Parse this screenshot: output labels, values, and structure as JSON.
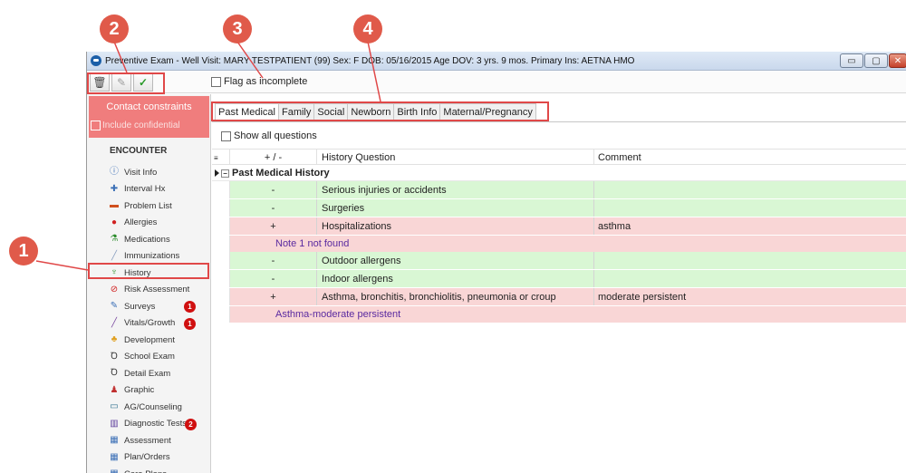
{
  "window": {
    "title": "Preventive Exam - Well Visit:  MARY TESTPATIENT (99)  Sex: F  DOB: 05/16/2015  Age DOV: 3 yrs. 9 mos.  Primary Ins: AETNA HMO",
    "controls": {
      "minimize": "▭",
      "maximize": "▢",
      "close": "✕"
    }
  },
  "toolbar": {
    "delete_icon": "trash-icon",
    "edit_icon": "pencil-icon",
    "confirm_icon": "check-icon",
    "flag_incomplete_label": "Flag as incomplete"
  },
  "sidebar": {
    "contact_constraints": "Contact constraints",
    "include_confidential": "Include confidential",
    "section_header": "ENCOUNTER",
    "items": [
      {
        "label": "Visit Info",
        "icon": "visit-info-icon",
        "glyph": "ⓘ",
        "color": "#3b6fb6"
      },
      {
        "label": "Interval Hx",
        "icon": "interval-hx-icon",
        "glyph": "✚",
        "color": "#3b6fb6"
      },
      {
        "label": "Problem List",
        "icon": "problem-list-icon",
        "glyph": "▬",
        "color": "#d0501e"
      },
      {
        "label": "Allergies",
        "icon": "allergies-icon",
        "glyph": "●",
        "color": "#d02020"
      },
      {
        "label": "Medications",
        "icon": "medications-icon",
        "glyph": "⚗",
        "color": "#2b8c2b"
      },
      {
        "label": "Immunizations",
        "icon": "immunizations-icon",
        "glyph": "╱",
        "color": "#8aa0c0"
      },
      {
        "label": "History",
        "icon": "history-icon",
        "glyph": "♆",
        "color": "#3c9a3c"
      },
      {
        "label": "Risk Assessment",
        "icon": "risk-assessment-icon",
        "glyph": "⊘",
        "color": "#d02020"
      },
      {
        "label": "Surveys",
        "icon": "surveys-icon",
        "glyph": "✎",
        "color": "#3b6fb6",
        "badge": "1"
      },
      {
        "label": "Vitals/Growth",
        "icon": "vitals-growth-icon",
        "glyph": "╱",
        "color": "#7a4aa0",
        "badge": "1"
      },
      {
        "label": "Development",
        "icon": "development-icon",
        "glyph": "♣",
        "color": "#e0a020"
      },
      {
        "label": "School Exam",
        "icon": "school-exam-icon",
        "glyph": "Ꝺ",
        "color": "#333333"
      },
      {
        "label": "Detail Exam",
        "icon": "detail-exam-icon",
        "glyph": "Ꝺ",
        "color": "#333333"
      },
      {
        "label": "Graphic",
        "icon": "graphic-icon",
        "glyph": "♟",
        "color": "#c03030"
      },
      {
        "label": "AG/Counseling",
        "icon": "ag-counseling-icon",
        "glyph": "▭",
        "color": "#2b6e8c"
      },
      {
        "label": "Diagnostic Tests",
        "icon": "diagnostic-tests-icon",
        "glyph": "▥",
        "color": "#5a3a9a",
        "badge": "2"
      },
      {
        "label": "Assessment",
        "icon": "assessment-icon",
        "glyph": "▦",
        "color": "#3b6fb6"
      },
      {
        "label": "Plan/Orders",
        "icon": "plan-orders-icon",
        "glyph": "▦",
        "color": "#3b6fb6"
      },
      {
        "label": "Care Plans",
        "icon": "care-plans-icon",
        "glyph": "▦",
        "color": "#3b6fb6"
      }
    ]
  },
  "tabs": [
    {
      "label": "Past Medical",
      "active": true
    },
    {
      "label": "Family",
      "active": false
    },
    {
      "label": "Social",
      "active": false
    },
    {
      "label": "Newborn",
      "active": false
    },
    {
      "label": "Birth Info",
      "active": false
    },
    {
      "label": "Maternal/Pregnancy",
      "active": false
    }
  ],
  "main": {
    "show_all_questions": "Show all questions",
    "columns": {
      "plusminus": "+ / -",
      "question": "History Question",
      "comment": "Comment"
    },
    "group_label": "Past Medical History",
    "rows": [
      {
        "pm": "-",
        "question": "Serious injuries or accidents",
        "comment": "",
        "status": "neg"
      },
      {
        "pm": "-",
        "question": "Surgeries",
        "comment": "",
        "status": "neg"
      },
      {
        "pm": "+",
        "question": "Hospitalizations",
        "comment": "asthma",
        "status": "pos",
        "note": "Note 1 not found"
      },
      {
        "pm": "-",
        "question": "Outdoor allergens",
        "comment": "",
        "status": "neg"
      },
      {
        "pm": "-",
        "question": "Indoor allergens",
        "comment": "",
        "status": "neg"
      },
      {
        "pm": "+",
        "question": "Asthma, bronchitis, bronchiolitis, pneumonia or croup",
        "comment": "moderate persistent",
        "status": "pos",
        "note": "Asthma-moderate persistent"
      }
    ]
  },
  "annotations": {
    "callout_1": "1",
    "callout_2": "2",
    "callout_3": "3",
    "callout_4": "4"
  },
  "colors": {
    "accent_red": "#e04848",
    "negative_row": "#d9f7d4",
    "positive_row": "#f9d6d6",
    "note_text": "#5a2aa0"
  }
}
